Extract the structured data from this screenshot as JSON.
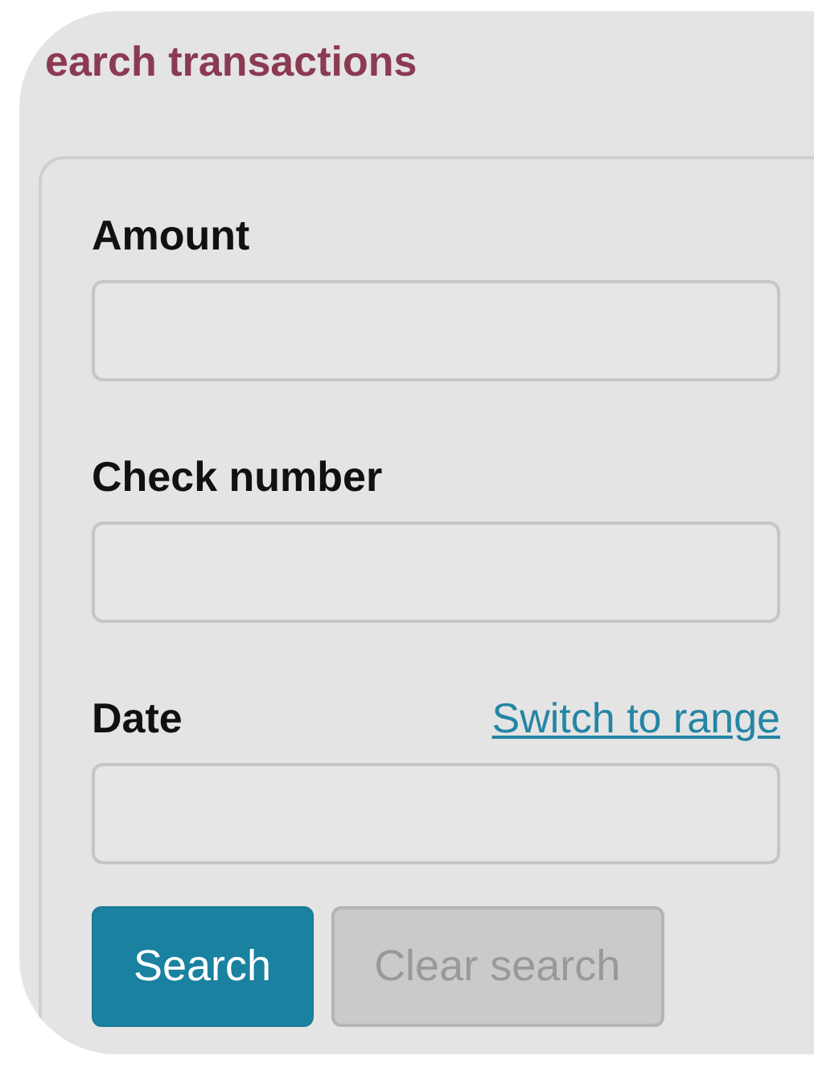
{
  "title": "earch transactions",
  "fields": [
    {
      "label": "Amount"
    },
    {
      "label": "Check number"
    },
    {
      "label": "Date",
      "link": "Switch to range"
    }
  ],
  "buttons": [
    {
      "label": "Search",
      "kind": "primary",
      "disabled": false
    },
    {
      "label": "Clear search",
      "kind": "secondary",
      "disabled": true
    }
  ]
}
